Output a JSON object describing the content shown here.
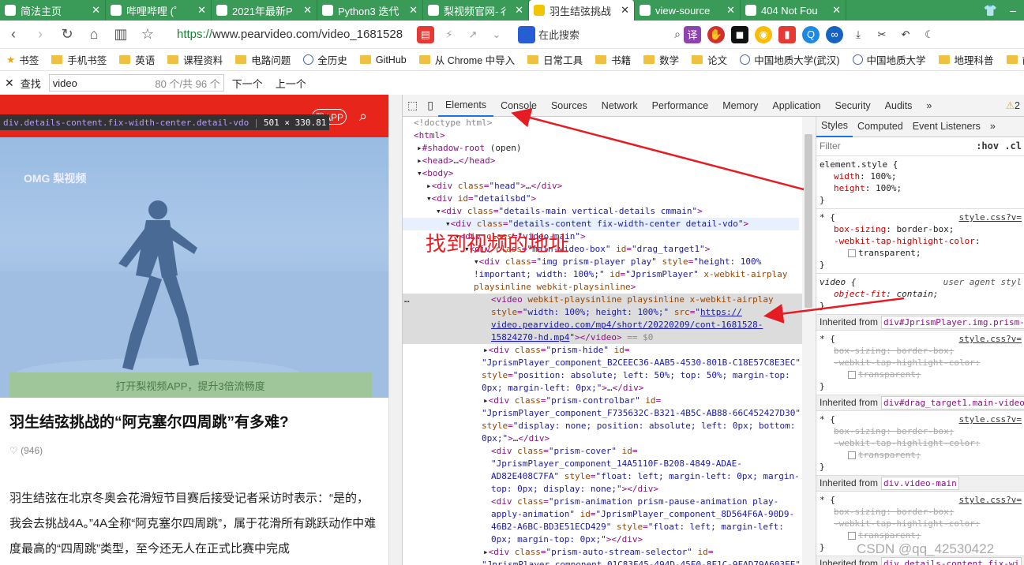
{
  "tabs": [
    {
      "label": "简法主页",
      "active": false
    },
    {
      "label": "哔哩哔哩 (゜",
      "active": false
    },
    {
      "label": "2021年最新P",
      "active": false
    },
    {
      "label": "Python3 迭代",
      "active": false
    },
    {
      "label": "梨视频官网-彳",
      "active": false
    },
    {
      "label": "羽生结弦挑战",
      "active": true
    },
    {
      "label": "view-source",
      "active": false
    },
    {
      "label": "404 Not Fou",
      "active": false
    }
  ],
  "nav": {
    "url_prefix": "https://",
    "url_host": "www.pearvideo.com",
    "url_path": "/video_1681528",
    "search_placeholder": "在此搜索"
  },
  "bookmarks": [
    "书签",
    "手机书签",
    "英语",
    "课程资料",
    "电路问题",
    "全历史",
    "GitHub",
    "从 Chrome 中导入",
    "日常工具",
    "书籍",
    "数学",
    "论文",
    "中国地质大学(武汉)",
    "中国地质大学",
    "地理科普",
    "前端"
  ],
  "findbar": {
    "label": "查找",
    "query": "video",
    "count": "80 个/共 96 个",
    "next": "下一个",
    "prev": "上一个"
  },
  "page": {
    "tooltip_selector": "div.details-content.fix-width-center.detail-vdo",
    "tooltip_size": "501 × 330.81",
    "open_app_label": "载APP",
    "watermark_logo": "OMG 梨视频",
    "banner": "打开梨视频APP，提升3倍流畅度",
    "title": "羽生结弦挑战的“阿克塞尔四周跳”有多难?",
    "likes": "(946)",
    "body": "羽生结弦在北京冬奥会花滑短节目赛后接受记者采访时表示：“是的，我会去挑战4A。”4A全称“阿克塞尔四周跳”，属于花滑所有跳跃动作中难度最高的“四周跳”类型，至今还无人在正式比赛中完成"
  },
  "devtools": {
    "tabs": [
      "Elements",
      "Console",
      "Sources",
      "Network",
      "Performance",
      "Memory",
      "Application",
      "Security",
      "Audits"
    ],
    "active_tab": "Elements",
    "warnings": "2",
    "annotation": "找到视频的地址",
    "styles_tabs": [
      "Styles",
      "Computed",
      "Event Listeners"
    ],
    "filter_placeholder": "Filter",
    "filter_hov": ":hov .cl",
    "video_src": "https://video.pearvideo.com/mp4/short/20220209/cont-1681528-15824270-hd.mp4"
  },
  "styles": {
    "element_style": {
      "selector": "element.style {",
      "width": "100%;",
      "height": "100%;"
    },
    "universal_source": "style.css?v=",
    "video_rule": {
      "selector": "video {",
      "source": "user agent styl",
      "prop": "object-fit",
      "value": "contain;"
    },
    "inherited": [
      "div#JprismPlayer.img.prism-",
      "div#drag_target1.main-video",
      "div.video-main",
      "div.details-content.fix-wi"
    ]
  },
  "watermark": "CSDN @qq_42530422"
}
